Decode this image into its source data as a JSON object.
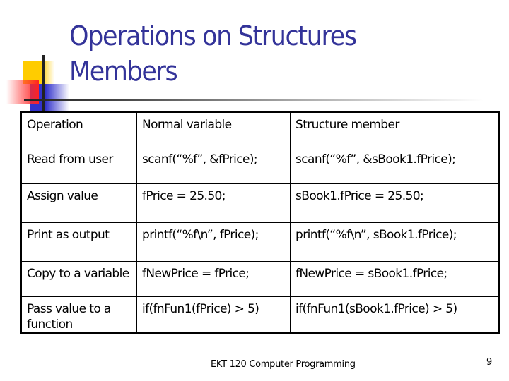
{
  "slide": {
    "title_line1": "Operations on Structures",
    "title_line2": "Members",
    "title_color": "#333399"
  },
  "table": {
    "headers": [
      "Operation",
      "Normal variable",
      "Structure member"
    ],
    "rows": [
      [
        "Read from user",
        "scanf(“%f”, &fPrice);",
        "scanf(“%f”, &sBook1.fPrice);"
      ],
      [
        "Assign value",
        "fPrice = 25.50;",
        "sBook1.fPrice = 25.50;"
      ],
      [
        "Print as output",
        "printf(“%f\\n”, fPrice);",
        "printf(“%f\\n”, sBook1.fPrice);"
      ],
      [
        "Copy to a variable",
        "fNewPrice = fPrice;",
        "fNewPrice = sBook1.fPrice;"
      ],
      [
        "Pass value to a function",
        "if(fnFun1(fPrice) > 5)",
        "if(fnFun1(sBook1.fPrice) > 5)"
      ]
    ]
  },
  "footer": {
    "course": "EKT 120 Computer Programming",
    "page_number": "9"
  },
  "decor": {
    "icon": "color-blocks-logo",
    "colors": [
      "#ffcc00",
      "#3333cc",
      "#ff2222"
    ]
  }
}
